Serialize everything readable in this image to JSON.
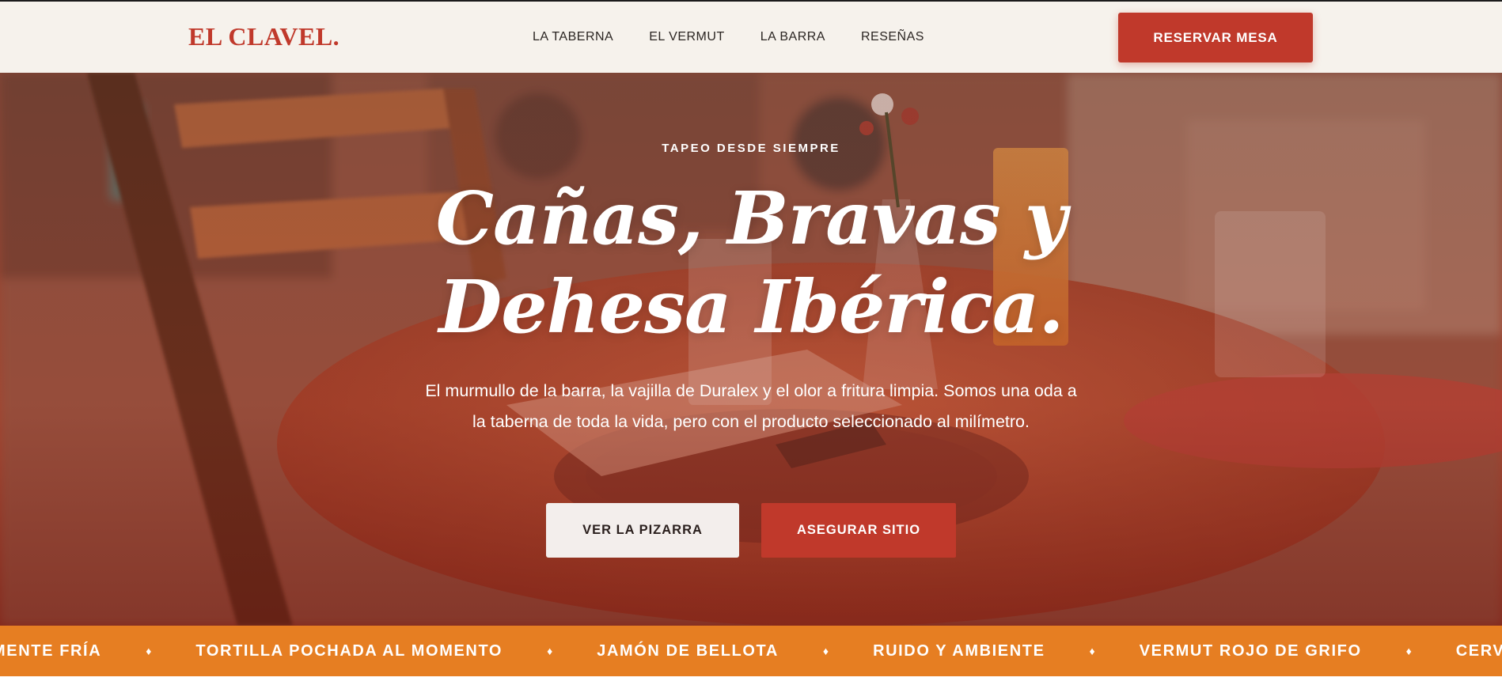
{
  "brand": {
    "logo": "EL CLAVEL."
  },
  "nav": {
    "links": [
      {
        "label": "LA TABERNA"
      },
      {
        "label": "EL VERMUT"
      },
      {
        "label": "LA BARRA"
      },
      {
        "label": "RESEÑAS"
      }
    ],
    "cta_label": "RESERVAR MESA"
  },
  "hero": {
    "eyebrow": "TAPEO DESDE SIEMPRE",
    "title_line1": "Cañas, Bravas y",
    "title_line2": "Dehesa Ibérica.",
    "subtitle": "El murmullo de la barra, la vajilla de Duralex y el olor a fritura limpia. Somos una oda a la taberna de toda la vida, pero con el producto seleccionado al milímetro.",
    "primary_button": "VER LA PIZARRA",
    "secondary_button": "ASEGURAR SITIO"
  },
  "ticker": {
    "separator": "♦",
    "items": [
      {
        "text": "AMENTE FRÍA"
      },
      {
        "text": "TORTILLA POCHADA AL MOMENTO"
      },
      {
        "text": "JAMÓN DE BELLOTA"
      },
      {
        "text": "RUIDO Y AMBIENTE"
      },
      {
        "text": "VERMUT ROJO DE GRIFO"
      },
      {
        "text": "CERVE"
      }
    ]
  },
  "colors": {
    "accent": "#c0392b",
    "ticker": "#e67e22",
    "nav_bg": "#f6f2ec"
  }
}
